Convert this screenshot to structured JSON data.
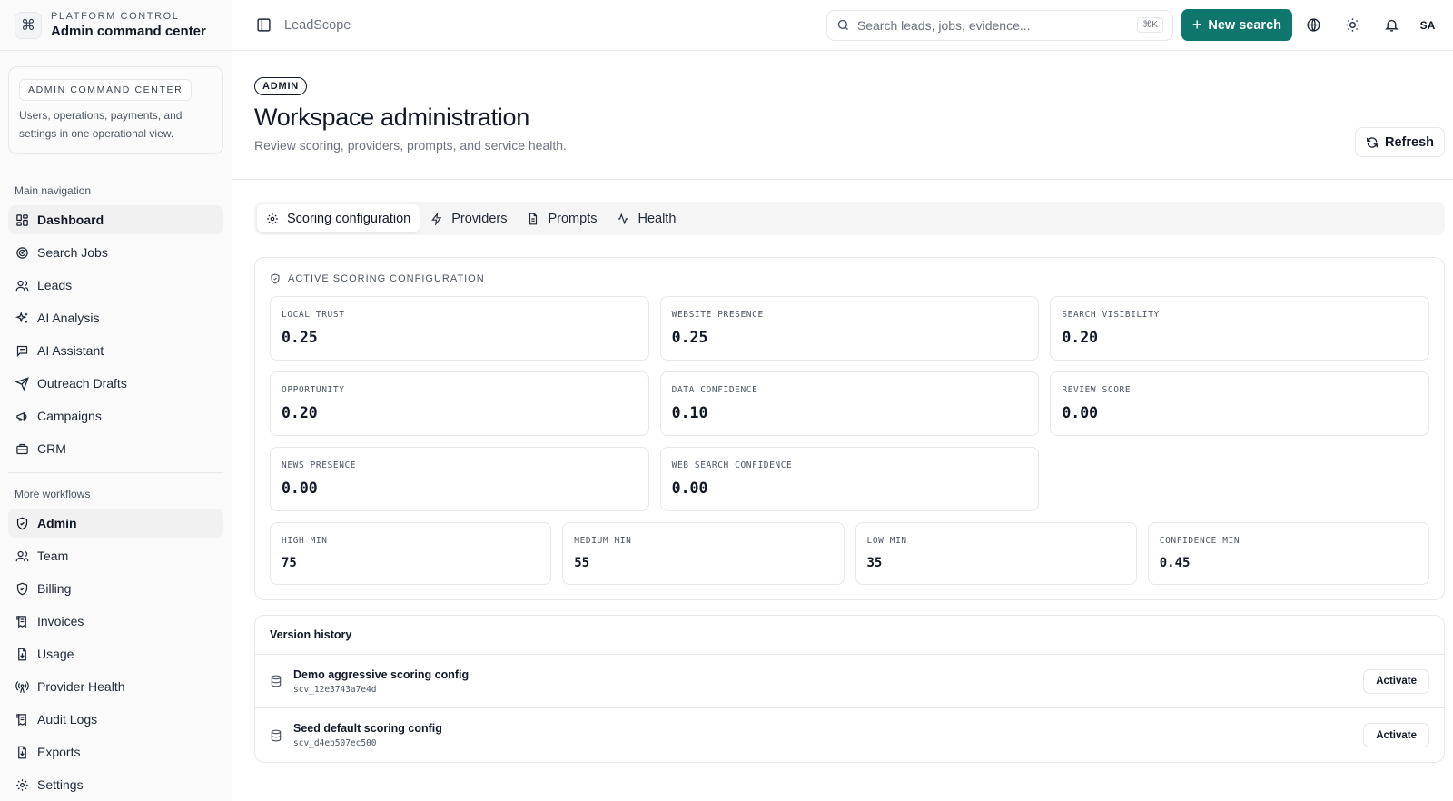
{
  "brand": {
    "eyebrow": "PLATFORM CONTROL",
    "title": "Admin command center",
    "icon": "command-icon"
  },
  "callout": {
    "pill": "ADMIN COMMAND CENTER",
    "text": "Users, operations, payments, and settings in one operational view."
  },
  "sidebar": {
    "main_section": "Main navigation",
    "main_items": [
      {
        "label": "Dashboard",
        "icon": "dashboard-icon",
        "active": true
      },
      {
        "label": "Search Jobs",
        "icon": "radar-icon"
      },
      {
        "label": "Leads",
        "icon": "users-icon"
      },
      {
        "label": "AI Analysis",
        "icon": "sparkles-icon"
      },
      {
        "label": "AI Assistant",
        "icon": "message-icon"
      },
      {
        "label": "Outreach Drafts",
        "icon": "send-icon"
      },
      {
        "label": "Campaigns",
        "icon": "megaphone-icon"
      },
      {
        "label": "CRM",
        "icon": "briefcase-icon"
      }
    ],
    "more_section": "More workflows",
    "more_items": [
      {
        "label": "Admin",
        "icon": "shield-icon",
        "active": true
      },
      {
        "label": "Team",
        "icon": "users-icon"
      },
      {
        "label": "Billing",
        "icon": "shield-icon"
      },
      {
        "label": "Invoices",
        "icon": "receipt-icon"
      },
      {
        "label": "Usage",
        "icon": "file-download-icon"
      },
      {
        "label": "Provider Health",
        "icon": "radio-icon"
      },
      {
        "label": "Audit Logs",
        "icon": "scroll-icon"
      },
      {
        "label": "Exports",
        "icon": "file-download-icon"
      },
      {
        "label": "Settings",
        "icon": "gear-icon"
      }
    ]
  },
  "topbar": {
    "breadcrumb": "LeadScope",
    "search_placeholder": "Search leads, jobs, evidence...",
    "search_shortcut": "⌘K",
    "new_search_label": "New search",
    "avatar_initials": "SA",
    "accent_color": "#0f766e"
  },
  "header": {
    "badge": "ADMIN",
    "title": "Workspace administration",
    "subtitle": "Review scoring, providers, prompts, and service health.",
    "refresh_label": "Refresh"
  },
  "tabs": [
    {
      "label": "Scoring configuration",
      "icon": "gear-icon",
      "active": true
    },
    {
      "label": "Providers",
      "icon": "zap-icon"
    },
    {
      "label": "Prompts",
      "icon": "file-text-icon"
    },
    {
      "label": "Health",
      "icon": "activity-icon"
    }
  ],
  "scoring": {
    "title": "ACTIVE SCORING CONFIGURATION",
    "weights": [
      {
        "label": "LOCAL TRUST",
        "value": "0.25"
      },
      {
        "label": "WEBSITE PRESENCE",
        "value": "0.25"
      },
      {
        "label": "SEARCH VISIBILITY",
        "value": "0.20"
      },
      {
        "label": "OPPORTUNITY",
        "value": "0.20"
      },
      {
        "label": "DATA CONFIDENCE",
        "value": "0.10"
      },
      {
        "label": "REVIEW SCORE",
        "value": "0.00"
      },
      {
        "label": "NEWS PRESENCE",
        "value": "0.00"
      },
      {
        "label": "WEB SEARCH CONFIDENCE",
        "value": "0.00"
      }
    ],
    "thresholds": [
      {
        "label": "HIGH MIN",
        "value": "75"
      },
      {
        "label": "MEDIUM MIN",
        "value": "55"
      },
      {
        "label": "LOW MIN",
        "value": "35"
      },
      {
        "label": "CONFIDENCE MIN",
        "value": "0.45"
      }
    ]
  },
  "versions": {
    "title": "Version history",
    "items": [
      {
        "name": "Demo aggressive scoring config",
        "id": "scv_12e3743a7e4d",
        "action": "Activate"
      },
      {
        "name": "Seed default scoring config",
        "id": "scv_d4eb507ec500",
        "action": "Activate"
      }
    ]
  }
}
